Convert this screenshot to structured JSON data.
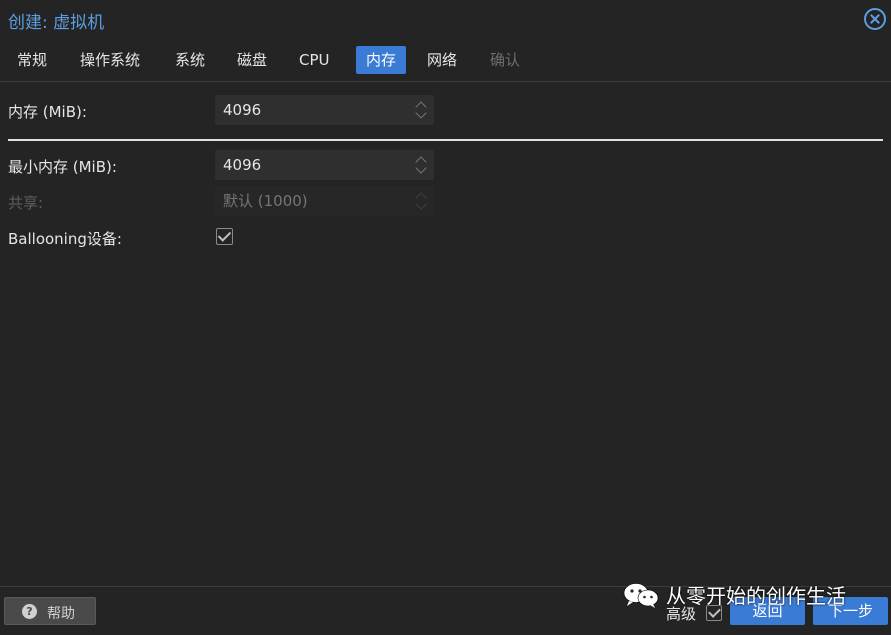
{
  "window": {
    "title": "创建: 虚拟机"
  },
  "tabs": [
    {
      "label": "常规",
      "state": "normal"
    },
    {
      "label": "操作系统",
      "state": "normal"
    },
    {
      "label": "系统",
      "state": "normal"
    },
    {
      "label": "磁盘",
      "state": "normal"
    },
    {
      "label": "CPU",
      "state": "normal"
    },
    {
      "label": "内存",
      "state": "active"
    },
    {
      "label": "网络",
      "state": "normal"
    },
    {
      "label": "确认",
      "state": "disabled"
    }
  ],
  "form": {
    "memory": {
      "label": "内存 (MiB):",
      "value": "4096"
    },
    "min_memory": {
      "label": "最小内存 (MiB):",
      "value": "4096"
    },
    "shares": {
      "label": "共享:",
      "placeholder": "默认 (1000)",
      "disabled": true
    },
    "ballooning": {
      "label": "Ballooning设备:",
      "checked": true
    }
  },
  "footer": {
    "help_label": "帮助",
    "help_icon": "question-circle-icon",
    "advanced_label": "高级",
    "advanced_checked": true,
    "back_label": "返回",
    "next_label": "下一步"
  },
  "watermark": {
    "icon": "wechat-icon",
    "text": "从零开始的创作生活"
  },
  "colors": {
    "background": "#242424",
    "accent": "#3a7bd5",
    "title": "#5c9ee0",
    "text": "#e6e6e6",
    "disabled_text": "#6e6e6e"
  }
}
